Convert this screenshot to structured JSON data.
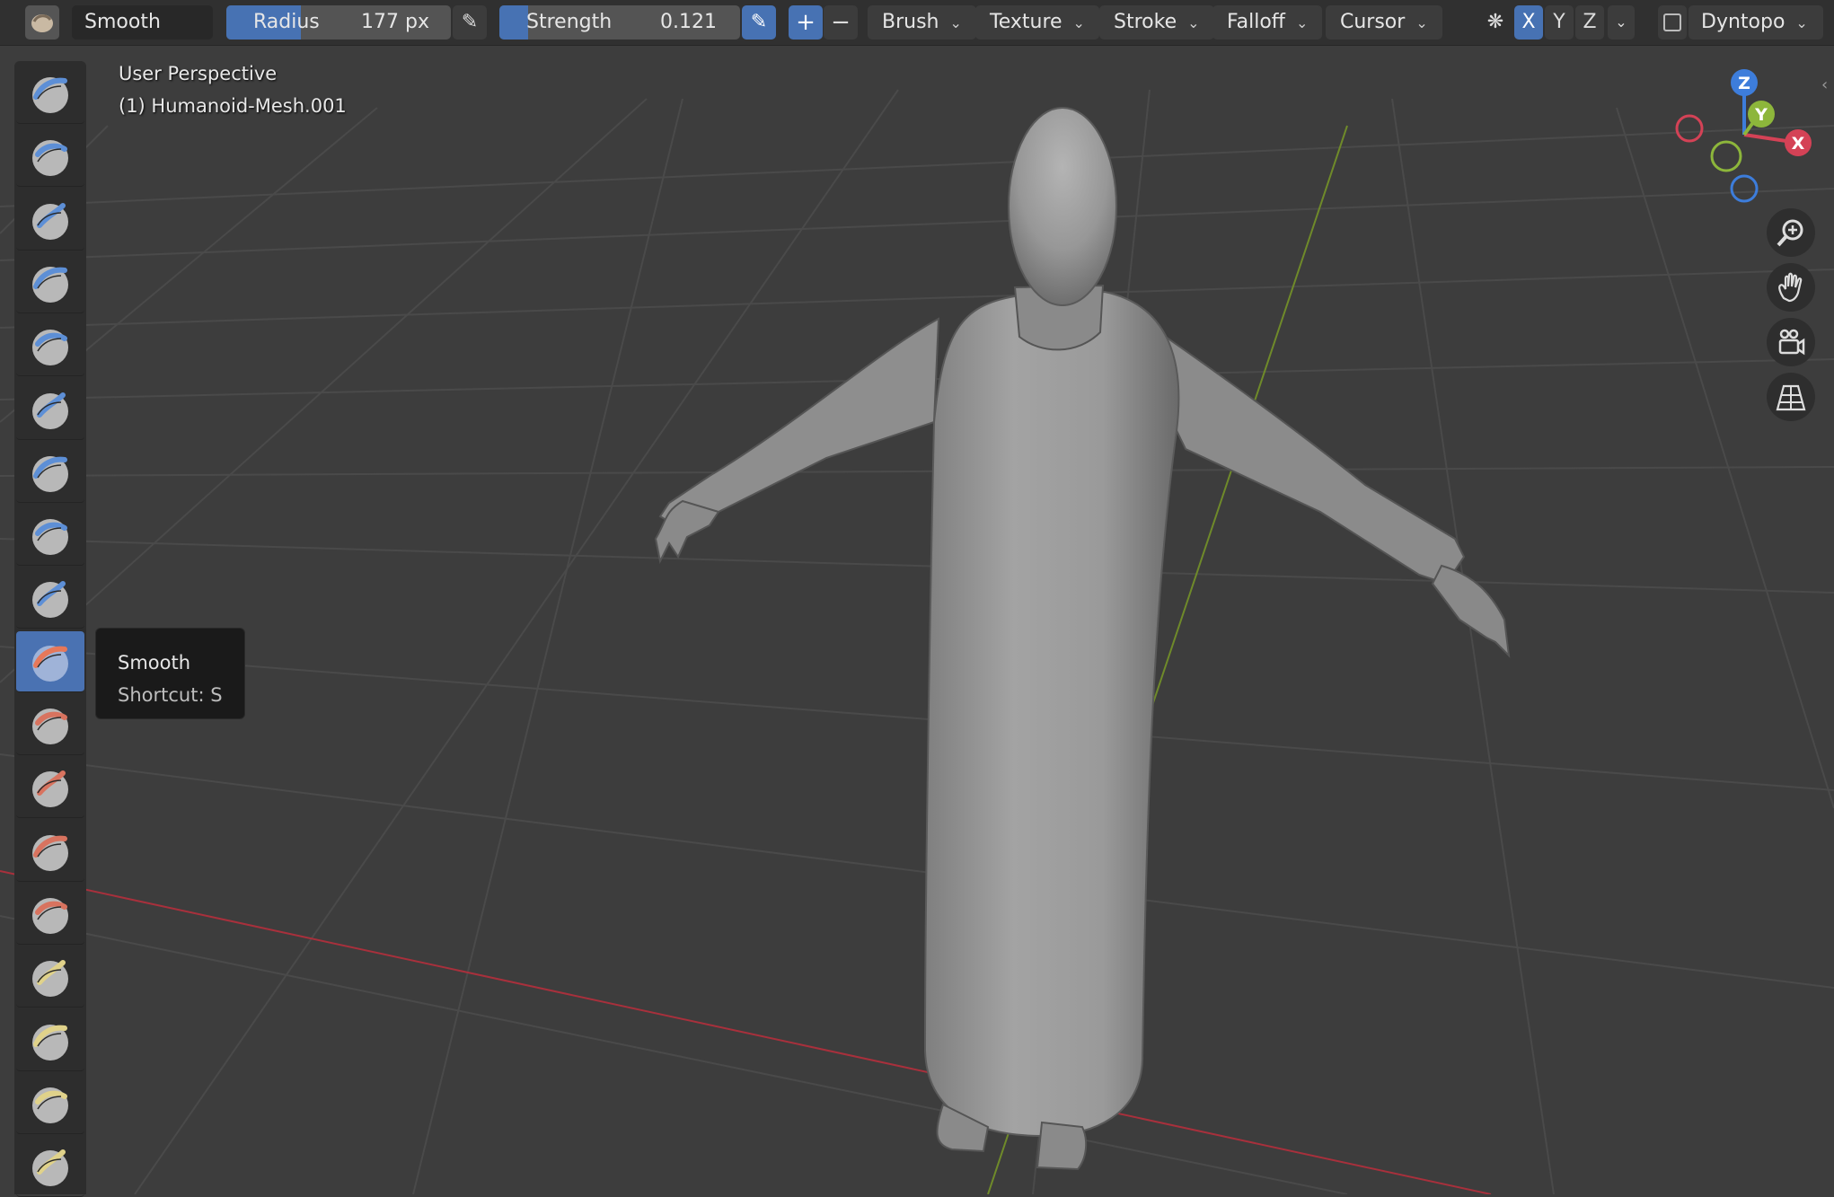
{
  "header": {
    "active_tool": "Smooth",
    "radius": {
      "label": "Radius",
      "value": "177 px",
      "fraction": 0.33
    },
    "strength": {
      "label": "Strength",
      "value": "0.121",
      "fraction": 0.121
    },
    "menus": [
      "Brush",
      "Texture",
      "Stroke",
      "Falloff",
      "Cursor"
    ],
    "axes": [
      "X",
      "Y",
      "Z"
    ],
    "dyntopo": "Dyntopo"
  },
  "viewport": {
    "view_name": "User Perspective",
    "object_name": "(1) Humanoid-Mesh.001"
  },
  "tooltip": {
    "title": "Smooth",
    "shortcut": "Shortcut: S"
  },
  "gizmo": {
    "x": "X",
    "y": "Y",
    "z": "Z"
  },
  "colors": {
    "accent": "#4772b3",
    "axis_x": "#d44256",
    "axis_y": "#8db63b",
    "axis_z": "#3d7ddb",
    "grid_red": "#a8303c",
    "grid_green": "#6f8a2a",
    "tool_highlight": "#e6785a",
    "tool_yellow": "#e0d28a"
  },
  "tools": [
    {
      "icon": "draw-brush-icon",
      "tone": "blue"
    },
    {
      "icon": "draw-sharp-brush-icon",
      "tone": "blue"
    },
    {
      "icon": "clay-brush-icon",
      "tone": "blue"
    },
    {
      "icon": "clay-strips-brush-icon",
      "tone": "blue"
    },
    {
      "icon": "clay-thumb-brush-icon",
      "tone": "blue"
    },
    {
      "icon": "layer-brush-icon",
      "tone": "blue"
    },
    {
      "icon": "inflate-brush-icon",
      "tone": "blue"
    },
    {
      "icon": "blob-brush-icon",
      "tone": "blue"
    },
    {
      "icon": "crease-brush-icon",
      "tone": "blue"
    },
    {
      "icon": "smooth-brush-icon",
      "tone": "orange",
      "active": true
    },
    {
      "icon": "flatten-brush-icon",
      "tone": "red"
    },
    {
      "icon": "fill-brush-icon",
      "tone": "red"
    },
    {
      "icon": "scrape-brush-icon",
      "tone": "red"
    },
    {
      "icon": "multiplane-scrape-brush-icon",
      "tone": "red"
    },
    {
      "icon": "pinch-brush-icon",
      "tone": "yellow"
    },
    {
      "icon": "grab-brush-icon",
      "tone": "yellow"
    },
    {
      "icon": "elastic-deform-brush-icon",
      "tone": "yellow"
    },
    {
      "icon": "snake-hook-brush-icon",
      "tone": "yellow"
    }
  ]
}
